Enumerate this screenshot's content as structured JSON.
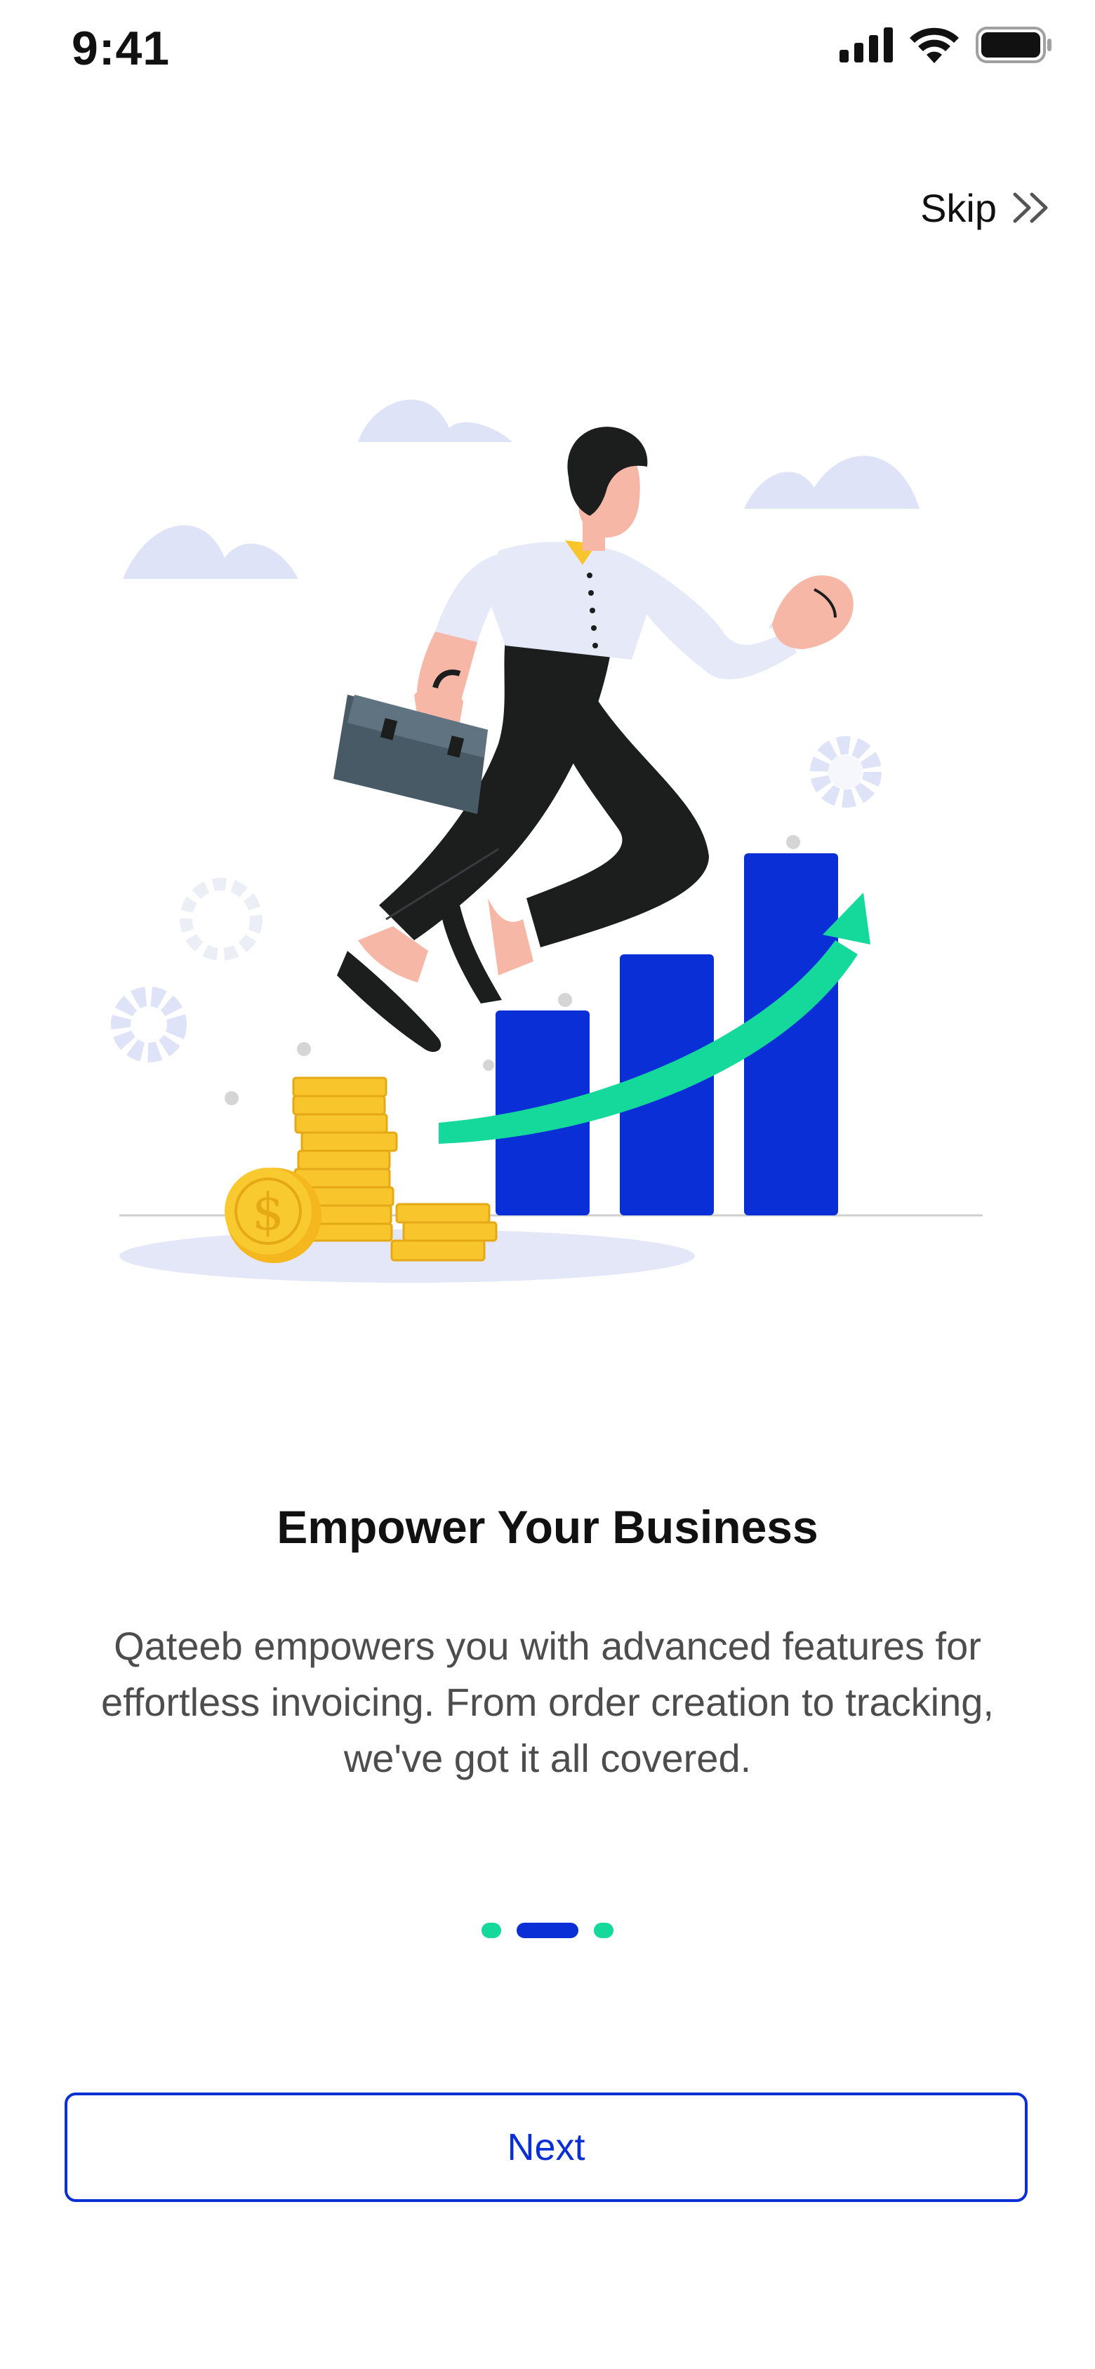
{
  "status_bar": {
    "time": "9:41",
    "icons": [
      "cellular-signal-icon",
      "wifi-icon",
      "battery-icon"
    ]
  },
  "skip": {
    "label": "Skip",
    "icon": "double-chevron-right-icon"
  },
  "illustration": {
    "subject": "businessman-jumping-over-growth-chart"
  },
  "onboarding": {
    "title": "Empower Your Business",
    "description": "Qateeb empowers you with advanced features for effortless invoicing. From order creation to tracking, we've got it all covered."
  },
  "pager": {
    "total": 3,
    "active_index": 1
  },
  "actions": {
    "next_label": "Next"
  },
  "colors": {
    "primary": "#0A2FD6",
    "accent": "#14D99B",
    "text": "#111111",
    "muted_text": "#4D4D4D",
    "cloud": "#DFE3F7"
  }
}
